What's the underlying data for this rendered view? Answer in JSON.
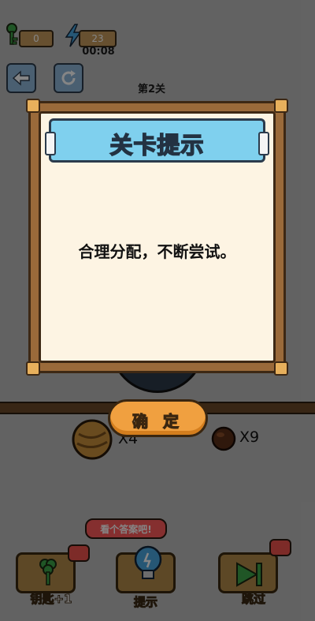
{
  "hud": {
    "keys": "0",
    "energy": "23",
    "timer": "00:08"
  },
  "level": {
    "label": "第2关"
  },
  "inventory": [
    {
      "name": "walnut",
      "count": "X4"
    },
    {
      "name": "chestnut",
      "count": "X9"
    }
  ],
  "dialog": {
    "title": "关卡提示",
    "hint": "合理分配，不断尝试。",
    "confirm_label": "确 定"
  },
  "bottom": {
    "bubble": "看个答案吧!",
    "key_label": "钥匙+1",
    "hint_label": "提示",
    "skip_label": "跳过"
  },
  "colors": {
    "banner": "#7fd0ee",
    "confirm": "#f0a040",
    "frame": "#9a6a3a",
    "panel": "#fdf4e3"
  }
}
